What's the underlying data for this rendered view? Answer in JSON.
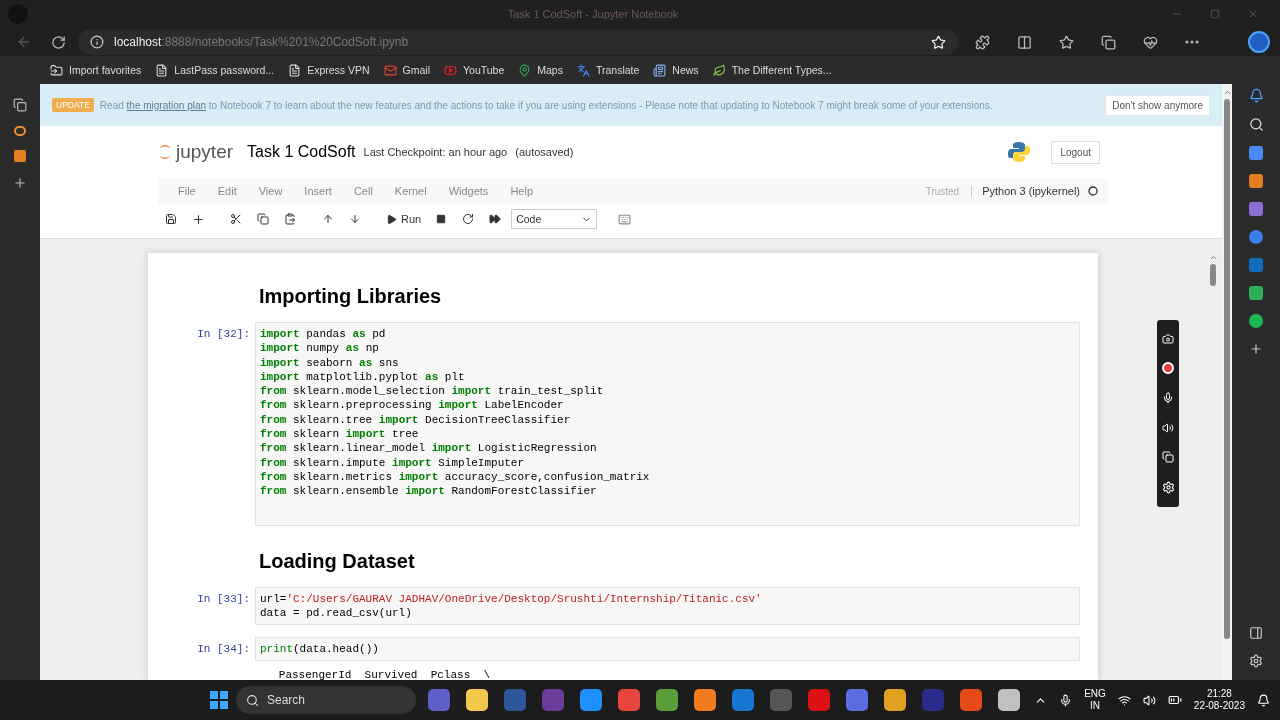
{
  "browser": {
    "window_title": "Task 1 CodSoft - Jupyter Notebook",
    "address_host": "localhost",
    "address_path": ":8888/notebooks/Task%201%20CodSoft.ipynb",
    "bookmarks": [
      {
        "label": "Import favorites",
        "kind": "import"
      },
      {
        "label": "LastPass password...",
        "kind": "page"
      },
      {
        "label": "Express VPN",
        "kind": "page"
      },
      {
        "label": "Gmail",
        "kind": "gmail"
      },
      {
        "label": "YouTube",
        "kind": "youtube"
      },
      {
        "label": "Maps",
        "kind": "maps"
      },
      {
        "label": "Translate",
        "kind": "translate"
      },
      {
        "label": "News",
        "kind": "news"
      },
      {
        "label": "The Different Types...",
        "kind": "leaf"
      }
    ]
  },
  "banner": {
    "badge": "UPDATE",
    "text_before": "Read ",
    "link": "the migration plan",
    "text_after": " to Notebook 7 to learn about the new features and the actions to take if you are using extensions - Please note that updating to Notebook 7 might break some of your extensions.",
    "dismiss": "Don't show anymore"
  },
  "notebook": {
    "logo": "jupyter",
    "name": "Task 1 CodSoft",
    "checkpoint": "Last Checkpoint: an hour ago",
    "autosave": "(autosaved)",
    "logout": "Logout",
    "menu": [
      "File",
      "Edit",
      "View",
      "Insert",
      "Cell",
      "Kernel",
      "Widgets",
      "Help"
    ],
    "trusted": "Trusted",
    "kernel": "Python 3 (ipykernel)",
    "run": "Run",
    "cell_type": "Code"
  },
  "cells": [
    {
      "kind": "markdown",
      "text": "Importing Libraries"
    },
    {
      "kind": "code",
      "prompt": "In [32]:",
      "lines": [
        [
          {
            "kind": "kw",
            "text": "import"
          },
          {
            "kind": "plain",
            "text": " pandas "
          },
          {
            "kind": "kw",
            "text": "as"
          },
          {
            "kind": "plain",
            "text": " pd"
          }
        ],
        [
          {
            "kind": "kw",
            "text": "import"
          },
          {
            "kind": "plain",
            "text": " numpy "
          },
          {
            "kind": "kw",
            "text": "as"
          },
          {
            "kind": "plain",
            "text": " np"
          }
        ],
        [
          {
            "kind": "kw",
            "text": "import"
          },
          {
            "kind": "plain",
            "text": " seaborn "
          },
          {
            "kind": "kw",
            "text": "as"
          },
          {
            "kind": "plain",
            "text": " sns"
          }
        ],
        [
          {
            "kind": "kw",
            "text": "import"
          },
          {
            "kind": "plain",
            "text": " matplotlib.pyplot "
          },
          {
            "kind": "kw",
            "text": "as"
          },
          {
            "kind": "plain",
            "text": " plt"
          }
        ],
        [
          {
            "kind": "kw",
            "text": "from"
          },
          {
            "kind": "plain",
            "text": " sklearn.model_selection "
          },
          {
            "kind": "kw",
            "text": "import"
          },
          {
            "kind": "plain",
            "text": " train_test_split"
          }
        ],
        [
          {
            "kind": "kw",
            "text": "from"
          },
          {
            "kind": "plain",
            "text": " sklearn.preprocessing "
          },
          {
            "kind": "kw",
            "text": "import"
          },
          {
            "kind": "plain",
            "text": " LabelEncoder"
          }
        ],
        [
          {
            "kind": "kw",
            "text": "from"
          },
          {
            "kind": "plain",
            "text": " sklearn.tree "
          },
          {
            "kind": "kw",
            "text": "import"
          },
          {
            "kind": "plain",
            "text": " DecisionTreeClassifier"
          }
        ],
        [
          {
            "kind": "kw",
            "text": "from"
          },
          {
            "kind": "plain",
            "text": " sklearn "
          },
          {
            "kind": "kw",
            "text": "import"
          },
          {
            "kind": "plain",
            "text": " tree"
          }
        ],
        [
          {
            "kind": "kw",
            "text": "from"
          },
          {
            "kind": "plain",
            "text": " sklearn.linear_model "
          },
          {
            "kind": "kw",
            "text": "import"
          },
          {
            "kind": "plain",
            "text": " LogisticRegression"
          }
        ],
        [
          {
            "kind": "kw",
            "text": "from"
          },
          {
            "kind": "plain",
            "text": " sklearn.impute "
          },
          {
            "kind": "kw",
            "text": "import"
          },
          {
            "kind": "plain",
            "text": " SimpleImputer"
          }
        ],
        [
          {
            "kind": "kw",
            "text": "from"
          },
          {
            "kind": "plain",
            "text": " sklearn.metrics "
          },
          {
            "kind": "kw",
            "text": "import"
          },
          {
            "kind": "plain",
            "text": " accuracy_score,confusion_matrix"
          }
        ],
        [
          {
            "kind": "kw",
            "text": "from"
          },
          {
            "kind": "plain",
            "text": " sklearn.ensemble "
          },
          {
            "kind": "kw",
            "text": "import"
          },
          {
            "kind": "plain",
            "text": " RandomForestClassifier"
          }
        ]
      ]
    },
    {
      "kind": "markdown",
      "text": "Loading Dataset"
    },
    {
      "kind": "code",
      "prompt": "In [33]:",
      "lines": [
        [
          {
            "kind": "plain",
            "text": "url="
          },
          {
            "kind": "str",
            "text": "'C:/Users/GAURAV JADHAV/OneDrive/Desktop/Srushti/Internship/Titanic.csv'"
          }
        ],
        [
          {
            "kind": "plain",
            "text": "data = pd.read_csv(url)"
          }
        ]
      ]
    },
    {
      "kind": "code",
      "prompt": "In [34]:",
      "lines": [
        [
          {
            "kind": "builtin",
            "text": "print"
          },
          {
            "kind": "plain",
            "text": "(data.head())"
          }
        ]
      ],
      "output": "   PassengerId  Survived  Pclass  \\"
    }
  ],
  "taskbar": {
    "search": "Search",
    "language": "ENG",
    "region": "IN",
    "time": "21:28",
    "date": "22-08-2023"
  }
}
